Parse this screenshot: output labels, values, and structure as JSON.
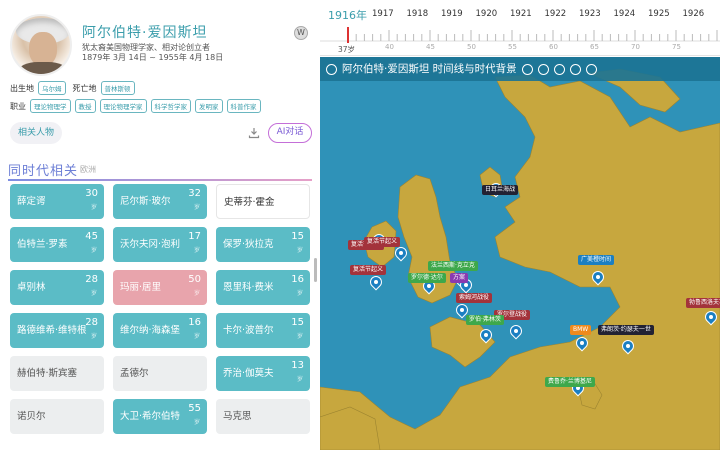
{
  "person": {
    "name": "阿尔伯特·爱因斯坦",
    "description": "犹太裔美国物理学家、相对论创立者",
    "life": "1879年 3月 14日 ~ 1955年 4月 18日",
    "birthplace_label": "出生地",
    "birthplace": "乌尔姆",
    "deathplace_label": "死亡地",
    "deathplace": "普林斯顿",
    "job_label": "职业",
    "jobs": [
      "理论物理学",
      "教授",
      "理论物理学家",
      "科学哲学家",
      "发明家",
      "科普作家"
    ]
  },
  "wiki_icon": "W",
  "buttons": {
    "related": "相关人物",
    "ai": "AI对话"
  },
  "section": {
    "title": "同时代相关",
    "subtitle": "欧洲"
  },
  "cards": [
    {
      "name": "薛定谔",
      "num": "30",
      "unit": "岁",
      "style": "teal"
    },
    {
      "name": "尼尔斯·玻尔",
      "num": "32",
      "unit": "岁",
      "style": "teal"
    },
    {
      "name": "史蒂芬·霍金",
      "num": "",
      "unit": "",
      "style": "white"
    },
    {
      "name": "伯特兰·罗素",
      "num": "45",
      "unit": "岁",
      "style": "teal"
    },
    {
      "name": "沃尔夫冈·泡利",
      "num": "17",
      "unit": "岁",
      "style": "teal"
    },
    {
      "name": "保罗·狄拉克",
      "num": "15",
      "unit": "岁",
      "style": "teal"
    },
    {
      "name": "卓别林",
      "num": "28",
      "unit": "岁",
      "style": "teal"
    },
    {
      "name": "玛丽·居里",
      "num": "50",
      "unit": "岁",
      "style": "pink"
    },
    {
      "name": "恩里科·费米",
      "num": "16",
      "unit": "岁",
      "style": "teal"
    },
    {
      "name": "路德维希·维特根",
      "num": "28",
      "unit": "岁",
      "style": "teal"
    },
    {
      "name": "维尔纳·海森堡",
      "num": "16",
      "unit": "岁",
      "style": "teal"
    },
    {
      "name": "卡尔·波普尔",
      "num": "15",
      "unit": "岁",
      "style": "teal"
    },
    {
      "name": "赫伯特·斯宾塞",
      "num": "",
      "unit": "",
      "style": "gray"
    },
    {
      "name": "孟德尔",
      "num": "",
      "unit": "",
      "style": "gray"
    },
    {
      "name": "乔治·伽莫夫",
      "num": "13",
      "unit": "岁",
      "style": "teal"
    },
    {
      "name": "诺贝尔",
      "num": "",
      "unit": "",
      "style": "gray"
    },
    {
      "name": "大卫·希尔伯特",
      "num": "55",
      "unit": "岁",
      "style": "teal"
    },
    {
      "name": "马克思",
      "num": "",
      "unit": "",
      "style": "gray"
    }
  ],
  "timeline": {
    "current_year": "1916年",
    "years": [
      "1917",
      "1918",
      "1919",
      "1920",
      "1921",
      "1922",
      "1923",
      "1924",
      "1925",
      "1926"
    ],
    "ages": [
      "40",
      "45",
      "50",
      "55",
      "60",
      "65",
      "70",
      "75"
    ],
    "current_age": "37岁",
    "current_marker_color": "#dd3333"
  },
  "map": {
    "title": "阿尔伯特·爱因斯坦 时间线与时代背景",
    "title_icons": [
      "copy-icon",
      "target-icon",
      "location-icon",
      "settings-icon",
      "play-icon"
    ],
    "sea_color": "#2f92b8",
    "land_color": "#c7a73e",
    "pins": [
      {
        "label": "日耳兰海战",
        "color": "#222233"
      },
      {
        "label": "复活节起义",
        "color": "#a3333b"
      },
      {
        "label": "复活节起义",
        "color": "#a3333b"
      },
      {
        "label": "复活节起义",
        "color": "#a3333b"
      },
      {
        "label": "法兰西斯·克立克",
        "color": "#3ea84b"
      },
      {
        "label": "罗尔德·达尔",
        "color": "#3ea84b"
      },
      {
        "label": "方案",
        "color": "#8a3ab0"
      },
      {
        "label": "索姆河战役",
        "color": "#a3333b"
      },
      {
        "label": "罗尔登战役",
        "color": "#a3333b"
      },
      {
        "label": "罗伯·弗林茨",
        "color": "#3ea84b"
      },
      {
        "label": "广美橙时间",
        "color": "#1b7fc2"
      },
      {
        "label": "BMW",
        "color": "#f08a1c"
      },
      {
        "label": "弗朗茨·约瑟夫一世",
        "color": "#222233"
      },
      {
        "label": "费鲁乔·兰博基尼",
        "color": "#3ea84b"
      },
      {
        "label": "勃鲁西洛夫攻势",
        "color": "#a3333b"
      }
    ]
  }
}
